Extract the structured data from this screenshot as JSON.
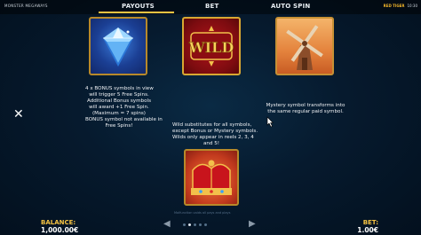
{
  "header": {
    "game_title": "MONSTER MEGAWAYS",
    "top_right_brand": "RED TIGER",
    "top_right_extra": "10:30"
  },
  "tabs": [
    {
      "label": "PAYOUTS",
      "active": true
    },
    {
      "label": "BET",
      "active": false
    },
    {
      "label": "AUTO SPIN",
      "active": false
    }
  ],
  "symbols": [
    {
      "name": "bonus",
      "icon": "diamond-icon",
      "description": [
        "4 x BONUS symbols in view",
        "will trigger 5 Free Spins.",
        "Additional Bonus symbols",
        "will award +1 Free Spin.",
        "(Maximum = 7 spins)",
        "BONUS symbol not available in",
        "Free Spins!"
      ]
    },
    {
      "name": "wild",
      "icon": "wild-icon",
      "tile_text": "WILD",
      "description": [
        "Wild substitutes for all symbols,",
        "except Bonus or Mystery symbols.",
        "Wilds only appear in reels 2, 3, 4",
        "and 5!"
      ]
    },
    {
      "name": "mystery",
      "icon": "windmill-icon",
      "description": [
        "Mystery symbol transforms into",
        "the same regular paid symbol."
      ]
    },
    {
      "name": "crown",
      "icon": "crown-icon",
      "description": []
    }
  ],
  "footer": {
    "balance_label": "BALANCE:",
    "balance_value": "1,000.00€",
    "bet_label": "BET:",
    "bet_value": "1.00€",
    "note": "Malfunction voids all pays and plays"
  },
  "pagination": {
    "total": 5,
    "active_index": 1
  },
  "colors": {
    "accent": "#f5c242",
    "background": "#061a2e"
  }
}
